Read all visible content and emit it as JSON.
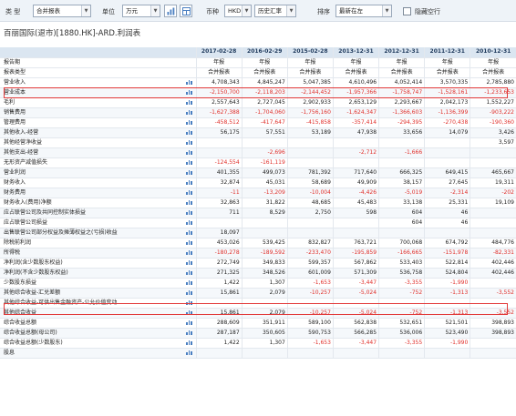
{
  "toolbar": {
    "type_label": "类 型",
    "type_value": "合并报表",
    "unit_label": "单位",
    "unit_value": "万元",
    "currency_label": "币种",
    "currency_value": "HKD",
    "rate_value": "历史汇率",
    "sort_label": "排序",
    "sort_value": "最新在左",
    "hide_empty_label": "隐藏空行",
    "dropdown_glyph": "▼"
  },
  "title": "百丽国际(退市)[1880.HK]-ARD.利润表",
  "columns": [
    "2017-02-28",
    "2016-02-29",
    "2015-02-28",
    "2013-12-31",
    "2012-12-31",
    "2011-12-31",
    "2010-12-31"
  ],
  "meta_rows": [
    {
      "label": "报告期",
      "values": [
        "年报",
        "年报",
        "年报",
        "年报",
        "年报",
        "年报",
        "年报"
      ]
    },
    {
      "label": "报表类型",
      "values": [
        "合并报表",
        "合并报表",
        "合并报表",
        "合并报表",
        "合并报表",
        "合并报表",
        "合并报表"
      ]
    }
  ],
  "rows": [
    {
      "label": "营业收入",
      "icon": true,
      "values": [
        "4,708,343",
        "4,845,247",
        "5,047,385",
        "4,610,496",
        "4,052,414",
        "3,570,335",
        "2,785,880"
      ]
    },
    {
      "label": "营业成本",
      "icon": true,
      "values": [
        "-2,150,700",
        "-2,118,203",
        "-2,144,452",
        "-1,957,366",
        "-1,758,747",
        "-1,528,161",
        "-1,233,653"
      ]
    },
    {
      "label": "毛利",
      "icon": true,
      "values": [
        "2,557,643",
        "2,727,045",
        "2,902,933",
        "2,653,129",
        "2,293,667",
        "2,042,173",
        "1,552,227"
      ]
    },
    {
      "label": "销售费用",
      "icon": true,
      "values": [
        "-1,627,388",
        "-1,704,060",
        "-1,756,160",
        "-1,624,347",
        "-1,366,603",
        "-1,136,399",
        "-903,222"
      ]
    },
    {
      "label": "管理费用",
      "icon": true,
      "values": [
        "-458,512",
        "-417,647",
        "-415,858",
        "-357,414",
        "-294,395",
        "-270,438",
        "-190,360"
      ]
    },
    {
      "label": "其他收入-经营",
      "icon": true,
      "values": [
        "56,175",
        "57,551",
        "53,189",
        "47,938",
        "33,656",
        "14,079",
        "3,426"
      ]
    },
    {
      "label": "其他经营净收益",
      "icon": true,
      "values": [
        "",
        "",
        "",
        "",
        "",
        "",
        "3,597"
      ]
    },
    {
      "label": "其他支出-经营",
      "icon": true,
      "values": [
        "",
        "-2,696",
        "",
        "-2,712",
        "-1,666",
        "",
        ""
      ]
    },
    {
      "label": "无形资产减值损失",
      "icon": true,
      "values": [
        "-124,554",
        "-161,119",
        "",
        "",
        "",
        "",
        ""
      ]
    },
    {
      "label": "营业利润",
      "icon": true,
      "values": [
        "401,355",
        "499,073",
        "781,392",
        "717,640",
        "666,325",
        "649,415",
        "465,667"
      ]
    },
    {
      "label": "财务收入",
      "icon": true,
      "values": [
        "32,874",
        "45,031",
        "58,689",
        "49,909",
        "38,157",
        "27,645",
        "19,311"
      ]
    },
    {
      "label": "财务费用",
      "icon": true,
      "values": [
        "-11",
        "-13,209",
        "-10,004",
        "-4,426",
        "-5,019",
        "-2,314",
        "-202"
      ]
    },
    {
      "label": "财务收入(费用)净额",
      "icon": true,
      "values": [
        "32,863",
        "31,822",
        "48,685",
        "45,483",
        "33,138",
        "25,331",
        "19,109"
      ]
    },
    {
      "label": "应占联营公司及共同控制实体损益",
      "icon": true,
      "values": [
        "711",
        "8,529",
        "2,750",
        "598",
        "604",
        "46",
        ""
      ]
    },
    {
      "label": "应占联营公司损益",
      "icon": true,
      "values": [
        "",
        "",
        "",
        "",
        "604",
        "46",
        ""
      ]
    },
    {
      "label": "出售联营公司部分权益及摊薄权益之(亏损)收益",
      "icon": true,
      "values": [
        "18,097",
        "",
        "",
        "",
        "",
        "",
        ""
      ]
    },
    {
      "label": "除税前利润",
      "icon": true,
      "values": [
        "453,026",
        "539,425",
        "832,827",
        "763,721",
        "700,068",
        "674,792",
        "484,776"
      ]
    },
    {
      "label": "所得税",
      "icon": true,
      "values": [
        "-180,278",
        "-189,592",
        "-233,470",
        "-195,859",
        "-166,665",
        "-151,978",
        "-82,331"
      ]
    },
    {
      "label": "净利润(含少数股东权益)",
      "icon": true,
      "values": [
        "272,749",
        "349,833",
        "599,357",
        "567,862",
        "533,403",
        "522,814",
        "402,446"
      ]
    },
    {
      "label": "净利润(不含少数股东权益)",
      "icon": true,
      "values": [
        "271,325",
        "348,526",
        "601,009",
        "571,309",
        "536,758",
        "524,804",
        "402,446"
      ]
    },
    {
      "label": "少数股东损益",
      "icon": true,
      "values": [
        "1,422",
        "1,307",
        "-1,653",
        "-3,447",
        "-3,355",
        "-1,990",
        ""
      ]
    },
    {
      "label": "其他综合收益-汇兑差额",
      "icon": true,
      "values": [
        "15,861",
        "2,079",
        "-10,257",
        "-5,024",
        "-752",
        "-1,313",
        "-3,552"
      ]
    },
    {
      "label": "其他综合收益-可供出售金融资产-公允价值变动",
      "icon": true,
      "values": [
        "",
        "",
        "",
        "",
        "",
        "",
        ""
      ]
    },
    {
      "label": "其他综合收益",
      "icon": true,
      "values": [
        "15,861",
        "2,079",
        "-10,257",
        "-5,024",
        "-752",
        "-1,313",
        "-3,552"
      ]
    },
    {
      "label": "综合收益总额",
      "icon": true,
      "values": [
        "288,609",
        "351,911",
        "589,100",
        "562,838",
        "532,651",
        "521,501",
        "398,893"
      ]
    },
    {
      "label": "综合收益总额(母公司)",
      "icon": true,
      "values": [
        "287,187",
        "350,605",
        "590,753",
        "566,285",
        "536,006",
        "523,490",
        "398,893"
      ]
    },
    {
      "label": "综合收益总额(少数股东)",
      "icon": true,
      "values": [
        "1,422",
        "1,307",
        "-1,653",
        "-3,447",
        "-3,355",
        "-1,990",
        ""
      ]
    },
    {
      "label": "股息",
      "icon": true,
      "values": [
        "",
        "",
        "",
        "",
        "",
        "",
        ""
      ]
    }
  ],
  "colors": {
    "highlight": "#e23a3a",
    "negative": "#e0302b",
    "header_bg": "#dbe6f1",
    "toolbar_bg": "#eef3f8"
  }
}
